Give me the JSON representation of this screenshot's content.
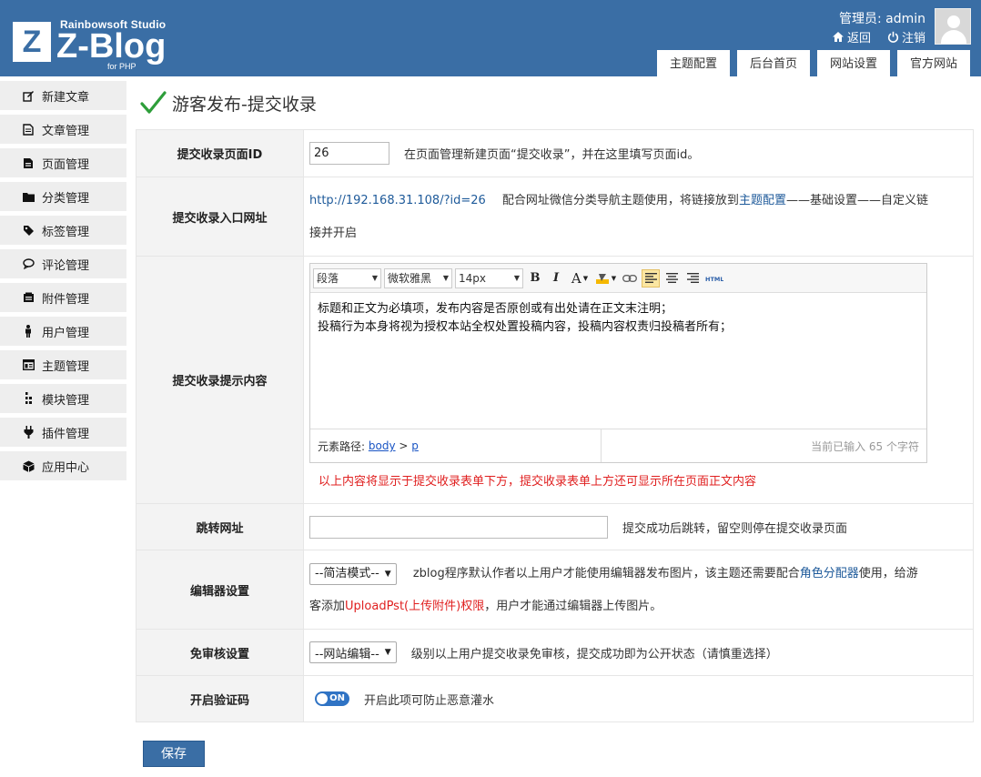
{
  "header": {
    "logo_mark": "Z",
    "logo_studio": "Rainbowsoft Studio",
    "logo_name": "Z-Blog",
    "logo_sub": "for PHP",
    "user_label": "管理员: admin",
    "back_label": "返回",
    "logout_label": "注销",
    "tabs": [
      "主题配置",
      "后台首页",
      "网站设置",
      "官方网站"
    ]
  },
  "sidebar": {
    "items": [
      {
        "label": "新建文章",
        "icon": "edit-icon"
      },
      {
        "label": "文章管理",
        "icon": "file-list-icon"
      },
      {
        "label": "页面管理",
        "icon": "page-icon"
      },
      {
        "label": "分类管理",
        "icon": "folder-icon"
      },
      {
        "label": "标签管理",
        "icon": "tag-icon"
      },
      {
        "label": "评论管理",
        "icon": "comment-icon"
      },
      {
        "label": "附件管理",
        "icon": "attachment-icon"
      },
      {
        "label": "用户管理",
        "icon": "user-icon"
      },
      {
        "label": "主题管理",
        "icon": "theme-icon"
      },
      {
        "label": "模块管理",
        "icon": "module-icon"
      },
      {
        "label": "插件管理",
        "icon": "plugin-icon"
      },
      {
        "label": "应用中心",
        "icon": "app-center-icon"
      }
    ]
  },
  "page": {
    "title": "游客发布-提交收录"
  },
  "form": {
    "page_id": {
      "label": "提交收录页面ID",
      "value": "26",
      "note": "在页面管理新建页面“提交收录”，并在这里填写页面id。"
    },
    "entry_url": {
      "label": "提交收录入口网址",
      "url": "http://192.168.31.108/?id=26",
      "note_a": "配合网址微信分类导航主题使用，将链接放到",
      "note_link": "主题配置",
      "note_b": "——基础设置——自定义链",
      "note_c": "接并开启"
    },
    "tip_content": {
      "label": "提交收录提示内容",
      "editor": {
        "paragraph": "段落",
        "font": "微软雅黑",
        "size": "14px",
        "line1": "标题和正文为必填项，发布内容是否原创或有出处请在正文末注明；",
        "line2": "投稿行为本身将视为授权本站全权处置投稿内容，投稿内容权责归投稿者所有；",
        "path_label": "元素路径:",
        "path_body": "body",
        "path_sep": ">",
        "path_p": "p",
        "count": "当前已输入 65 个字符"
      },
      "hint": "以上内容将显示于提交收录表单下方，提交收录表单上方还可显示所在页面正文内容"
    },
    "redirect": {
      "label": "跳转网址",
      "value": "",
      "note": "提交成功后跳转，留空则停在提交收录页面"
    },
    "editor_setting": {
      "label": "编辑器设置",
      "selected": "--简洁模式--",
      "note_a": "zblog程序默认作者以上用户才能使用编辑器发布图片，该主题还需要配合",
      "note_link": "角色分配器",
      "note_b": "使用，给游",
      "note_c": "客添加",
      "note_red": "UploadPst(上传附件)权限",
      "note_d": "，用户才能通过编辑器上传图片。"
    },
    "no_review": {
      "label": "免审核设置",
      "selected": "--网站编辑--",
      "note": "级别以上用户提交收录免审核，提交成功即为公开状态（请慎重选择）"
    },
    "captcha": {
      "label": "开启验证码",
      "toggle": "ON",
      "toggle_on": true,
      "note": "开启此项可防止恶意灌水"
    }
  },
  "save_label": "保存",
  "colors": {
    "brand": "#3a6ea5",
    "link": "#1e5a9a",
    "warning": "#e02020",
    "check": "#2e9e3a"
  }
}
